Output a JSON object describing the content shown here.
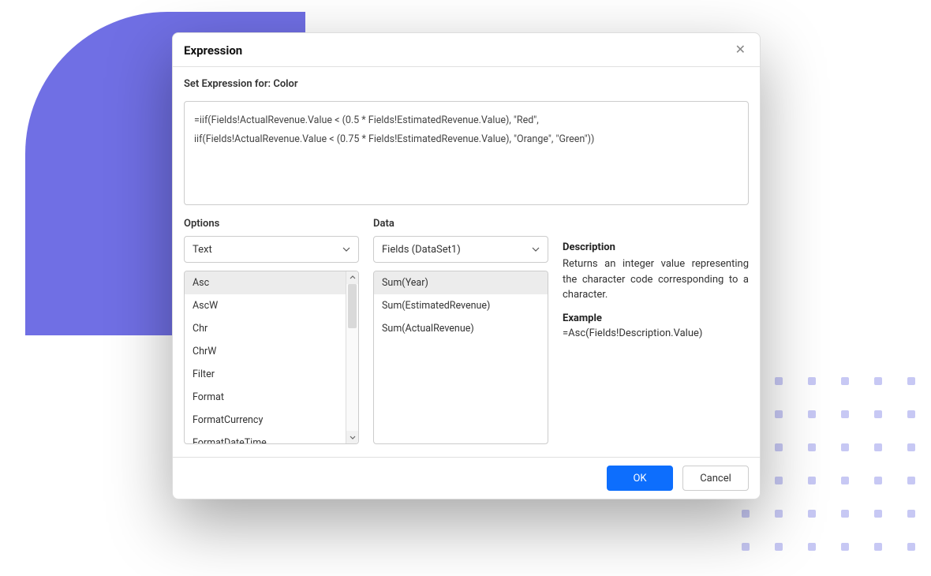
{
  "dialog": {
    "title": "Expression",
    "subtitle": "Set Expression for: Color",
    "expression": "=iif(Fields!ActualRevenue.Value < (0.5 * Fields!EstimatedRevenue.Value), \"Red\",\niif(Fields!ActualRevenue.Value < (0.75 * Fields!EstimatedRevenue.Value), \"Orange\", \"Green\"))"
  },
  "options": {
    "label": "Options",
    "selected": "Text",
    "items": [
      "Asc",
      "AscW",
      "Chr",
      "ChrW",
      "Filter",
      "Format",
      "FormatCurrency",
      "FormatDateTime"
    ],
    "selectedIndex": 0
  },
  "data": {
    "label": "Data",
    "selected": "Fields (DataSet1)",
    "items": [
      "Sum(Year)",
      "Sum(EstimatedRevenue)",
      "Sum(ActualRevenue)"
    ],
    "selectedIndex": 0
  },
  "info": {
    "descriptionLabel": "Description",
    "description": "Returns an integer value representing the character code corresponding to a character.",
    "exampleLabel": "Example",
    "example": "=Asc(Fields!Description.Value)"
  },
  "footer": {
    "ok": "OK",
    "cancel": "Cancel"
  }
}
